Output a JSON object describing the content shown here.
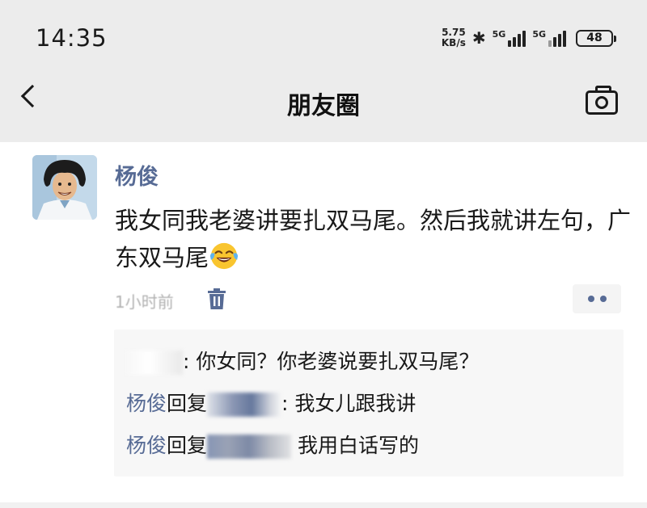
{
  "status_bar": {
    "time": "14:35",
    "net_speed_value": "5.75",
    "net_speed_unit": "KB/s",
    "bluetooth": "bluetooth-icon",
    "sim1_type": "5G",
    "sim2_type": "5G",
    "battery": "48"
  },
  "nav": {
    "title": "朋友圈",
    "back_icon": "chevron-left-icon",
    "camera_icon": "camera-icon"
  },
  "post": {
    "author": "杨俊",
    "text_before_emoji": "我女同我老婆讲要扎双马尾。然后我就讲左句，广东双马尾",
    "emoji": "tears-of-joy-emoji",
    "timestamp": "1小时前",
    "delete_icon": "trash-icon",
    "more_icon": "more-dots-icon"
  },
  "comments": [
    {
      "author": "",
      "reply_to": "",
      "separator": ":",
      "text": "你女同？你老婆说要扎双马尾？"
    },
    {
      "author": "杨俊",
      "reply_word": "回复",
      "separator": ":",
      "text": "我女儿跟我讲"
    },
    {
      "author": "杨俊",
      "reply_word": "回复",
      "separator": "",
      "text": "我用白话写的"
    }
  ],
  "colors": {
    "name_blue": "#576b95",
    "header_bg": "#ececec",
    "comment_bg": "#f7f7f7",
    "timestamp_gray": "#b2b2b2"
  }
}
